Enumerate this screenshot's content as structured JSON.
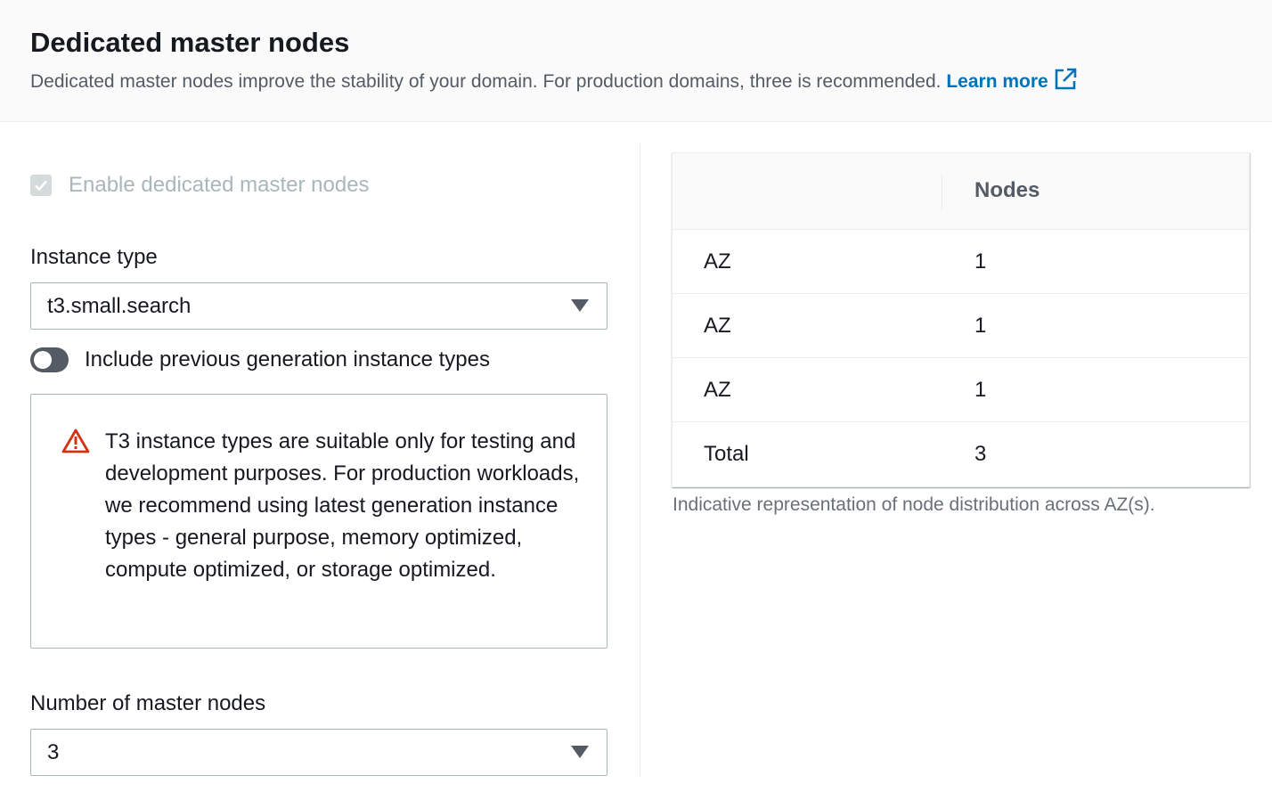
{
  "header": {
    "title": "Dedicated master nodes",
    "description": "Dedicated master nodes improve the stability of your domain. For production domains, three is recommended.",
    "learn_more": "Learn more"
  },
  "enable_checkbox": {
    "label": "Enable dedicated master nodes",
    "checked": true,
    "disabled": true
  },
  "instance_type": {
    "label": "Instance type",
    "value": "t3.small.search"
  },
  "previous_gen_toggle": {
    "label": "Include previous generation instance types",
    "on": false
  },
  "warning": {
    "text": "T3 instance types are suitable only for testing and development purposes. For production workloads, we recommend using latest generation instance types - general purpose, memory optimized, compute optimized, or storage optimized."
  },
  "master_nodes": {
    "label": "Number of master nodes",
    "value": "3"
  },
  "distribution_table": {
    "columns": [
      "",
      "Nodes"
    ],
    "rows": [
      {
        "az": "AZ",
        "nodes": "1"
      },
      {
        "az": "AZ",
        "nodes": "1"
      },
      {
        "az": "AZ",
        "nodes": "1"
      },
      {
        "az": "Total",
        "nodes": "3"
      }
    ],
    "caption": "Indicative representation of node distribution across AZ(s)."
  },
  "colors": {
    "link": "#0073bb",
    "warning_icon": "#d13212",
    "toggle_off": "#545b64"
  }
}
